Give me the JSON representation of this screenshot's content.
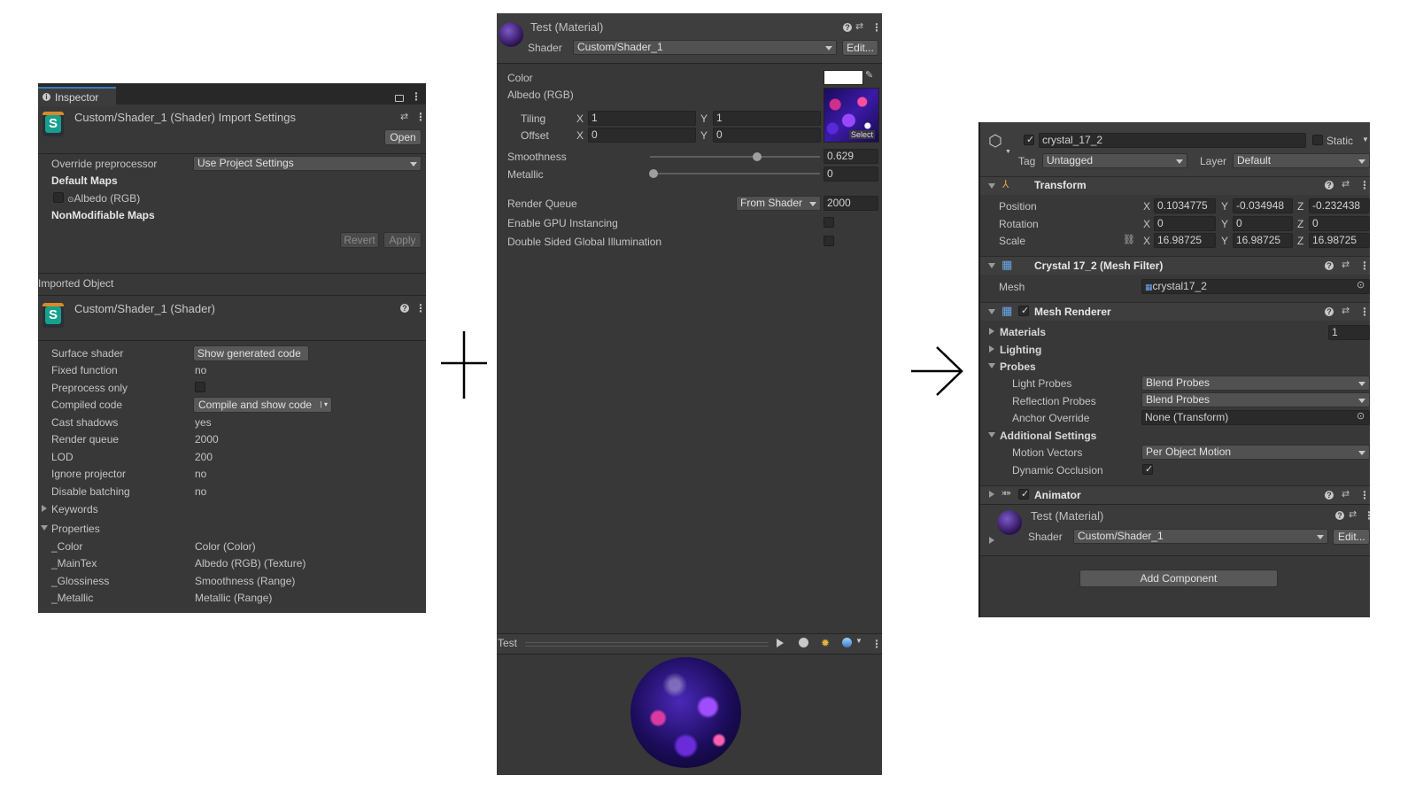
{
  "left_panel": {
    "tab_title": "Inspector",
    "import_title": "Custom/Shader_1 (Shader) Import Settings",
    "open_button": "Open",
    "override_label": "Override preprocessor",
    "override_value": "Use Project Settings",
    "default_maps": "Default Maps",
    "albedo_map": "Albedo (RGB)",
    "non_modifiable": "NonModifiable Maps",
    "revert": "Revert",
    "apply": "Apply",
    "imported_object": "Imported Object",
    "shader_title": "Custom/Shader_1 (Shader)",
    "rows": [
      {
        "label": "Surface shader",
        "value": "Show generated code"
      },
      {
        "label": "Fixed function",
        "value": "no"
      },
      {
        "label": "Preprocess only",
        "value": ""
      },
      {
        "label": "Compiled code",
        "value": "Compile and show code"
      },
      {
        "label": "Cast shadows",
        "value": "yes"
      },
      {
        "label": "Render queue",
        "value": "2000"
      },
      {
        "label": "LOD",
        "value": "200"
      },
      {
        "label": "Ignore projector",
        "value": "no"
      },
      {
        "label": "Disable batching",
        "value": "no"
      }
    ],
    "keywords": "Keywords",
    "properties": "Properties",
    "props": [
      {
        "name": "_Color",
        "type": "Color (Color)"
      },
      {
        "name": "_MainTex",
        "type": "Albedo (RGB) (Texture)"
      },
      {
        "name": "_Glossiness",
        "type": "Smoothness (Range)"
      },
      {
        "name": "_Metallic",
        "type": "Metallic (Range)"
      }
    ]
  },
  "plus_symbol": "+",
  "arrow_symbol": "→",
  "material_panel": {
    "title": "Test (Material)",
    "shader_label": "Shader",
    "shader_value": "Custom/Shader_1",
    "edit_button": "Edit...",
    "color_label": "Color",
    "albedo_label": "Albedo (RGB)",
    "tiling_label": "Tiling",
    "offset_label": "Offset",
    "x_label": "X",
    "y_label": "Y",
    "tiling_x": "1",
    "tiling_y": "1",
    "offset_x": "0",
    "offset_y": "0",
    "select_label": "Select",
    "smoothness_label": "Smoothness",
    "smoothness_value": "0.629",
    "smoothness_fraction": 0.629,
    "metallic_label": "Metallic",
    "metallic_value": "0",
    "metallic_fraction": 0,
    "render_queue_label": "Render Queue",
    "render_queue_mode": "From Shader",
    "render_queue_value": "2000",
    "gpu_instancing": "Enable GPU Instancing",
    "double_sided": "Double Sided Global Illumination",
    "preview_label": "Test"
  },
  "right_panel": {
    "object_name": "crystal_17_2",
    "static_label": "Static",
    "tag_label": "Tag",
    "tag_value": "Untagged",
    "layer_label": "Layer",
    "layer_value": "Default",
    "transform_title": "Transform",
    "position_label": "Position",
    "rotation_label": "Rotation",
    "scale_label": "Scale",
    "axis_x": "X",
    "axis_y": "Y",
    "axis_z": "Z",
    "position": [
      "0.1034775",
      "-0.034948",
      "-0.232438"
    ],
    "rotation": [
      "0",
      "0",
      "0"
    ],
    "scale": [
      "16.98725",
      "16.98725",
      "16.98725"
    ],
    "mesh_filter_title": "Crystal 17_2 (Mesh Filter)",
    "mesh_label": "Mesh",
    "mesh_value": "crystal17_2",
    "mesh_renderer_title": "Mesh Renderer",
    "materials_label": "Materials",
    "materials_count": "1",
    "lighting_label": "Lighting",
    "probes_label": "Probes",
    "light_probes_label": "Light Probes",
    "light_probes_value": "Blend Probes",
    "reflection_probes_label": "Reflection Probes",
    "reflection_probes_value": "Blend Probes",
    "anchor_override_label": "Anchor Override",
    "anchor_override_value": "None (Transform)",
    "additional_settings_label": "Additional Settings",
    "motion_vectors_label": "Motion Vectors",
    "motion_vectors_value": "Per Object Motion",
    "dynamic_occlusion_label": "Dynamic Occlusion",
    "animator_title": "Animator",
    "material_title": "Test (Material)",
    "shader_label": "Shader",
    "shader_value": "Custom/Shader_1",
    "edit_button": "Edit...",
    "add_component": "Add Component"
  },
  "colors": {
    "panel_bg": "#383838",
    "field_bg": "#2a2a2a",
    "shader_icon": "#16a08d"
  }
}
